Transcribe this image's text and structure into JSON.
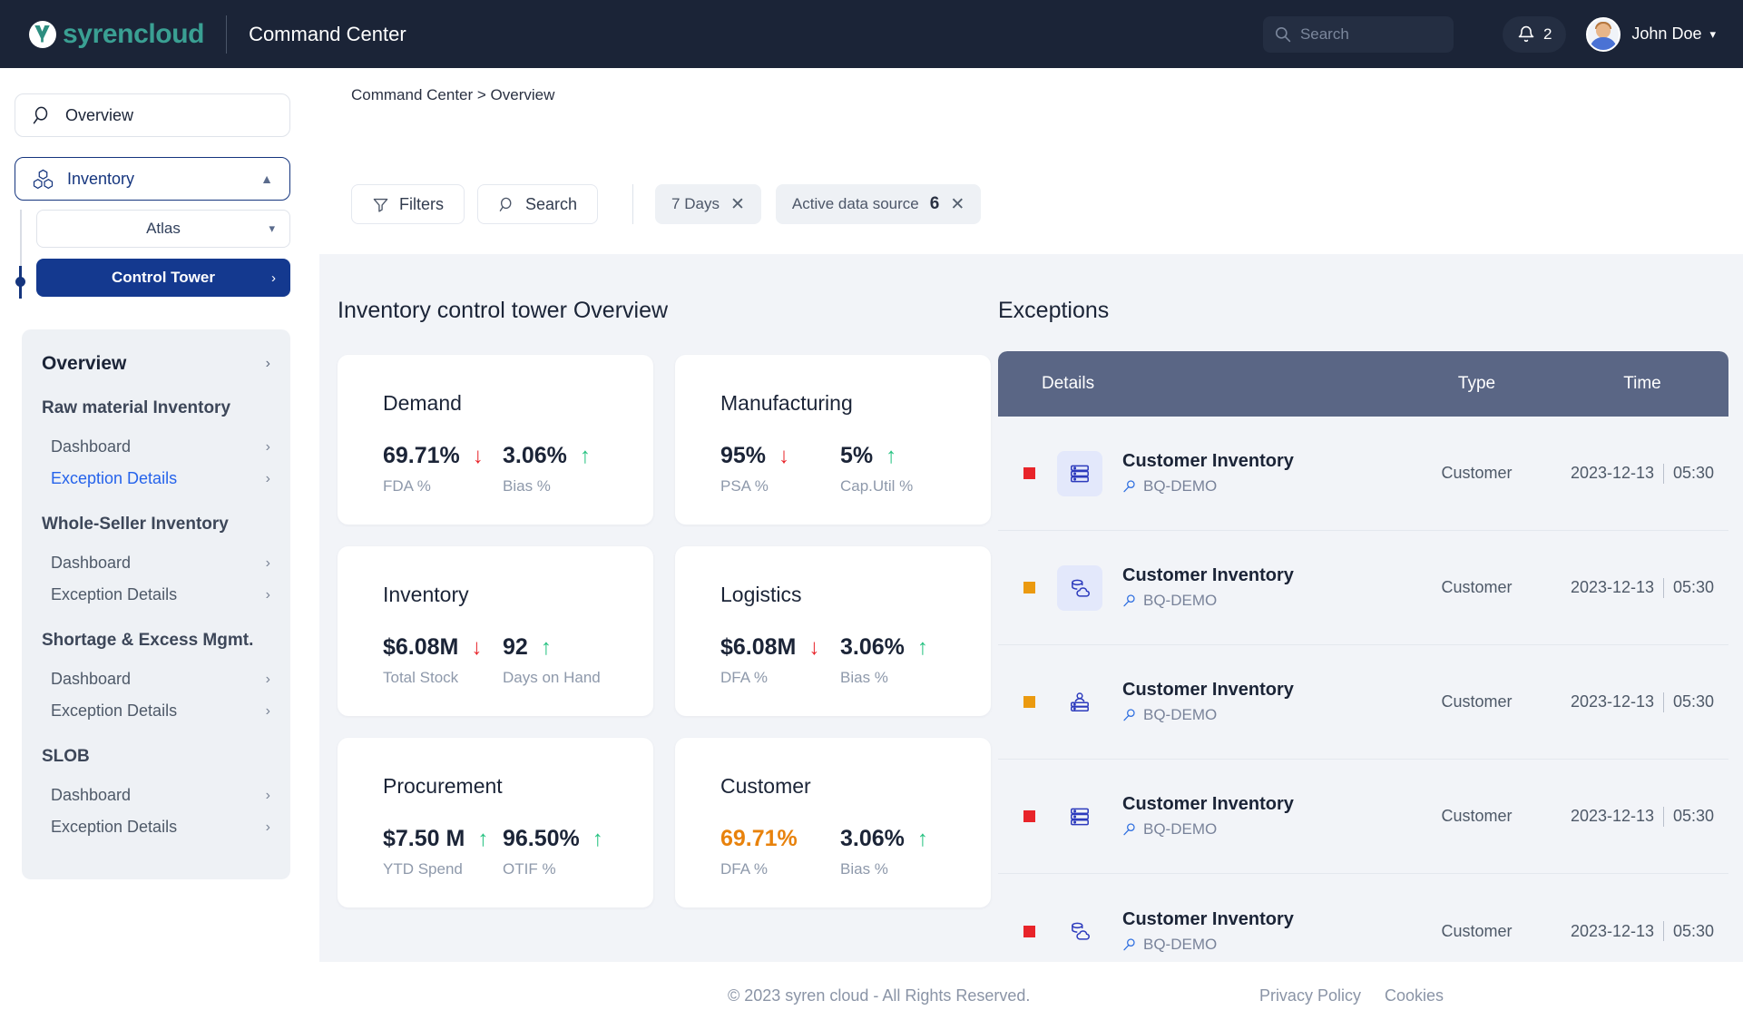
{
  "header": {
    "brand_word1": "syren",
    "brand_word2": "cloud",
    "app_title": "Command Center",
    "search_placeholder": "Search",
    "notification_count": "2",
    "user_name": "John Doe"
  },
  "sidebar": {
    "overview_label": "Overview",
    "inventory_label": "Inventory",
    "select_value": "Atlas",
    "control_tower_label": "Control Tower",
    "panel_title": "Overview",
    "groups": [
      {
        "title": "Raw material Inventory",
        "items": [
          {
            "label": "Dashboard",
            "highlight": false
          },
          {
            "label": "Exception  Details",
            "highlight": true
          }
        ]
      },
      {
        "title": "Whole-Seller Inventory",
        "items": [
          {
            "label": "Dashboard",
            "highlight": false
          },
          {
            "label": "Exception  Details",
            "highlight": false
          }
        ]
      },
      {
        "title": "Shortage & Excess Mgmt.",
        "items": [
          {
            "label": "Dashboard",
            "highlight": false
          },
          {
            "label": "Exception  Details",
            "highlight": false
          }
        ]
      },
      {
        "title": "SLOB",
        "items": [
          {
            "label": "Dashboard",
            "highlight": false
          },
          {
            "label": "Exception  Details",
            "highlight": false
          }
        ]
      }
    ]
  },
  "main": {
    "breadcrumb": "Command Center > Overview",
    "toolbar": {
      "filters_label": "Filters",
      "search_label": "Search",
      "chip_days_label": "7 Days",
      "chip_source_label": "Active data source",
      "chip_source_count": "6"
    },
    "kpi_section_title": "Inventory control tower  Overview",
    "exceptions_title": "Exceptions"
  },
  "chart_data": {
    "type": "table",
    "title": "Inventory control tower  Overview",
    "cards": [
      {
        "name": "Demand",
        "metrics": [
          {
            "value": "69.71%",
            "label": "FDA %",
            "trend": "down",
            "accent": "normal"
          },
          {
            "value": "3.06%",
            "label": "Bias %",
            "trend": "up",
            "accent": "normal"
          }
        ]
      },
      {
        "name": "Manufacturing",
        "metrics": [
          {
            "value": "95%",
            "label": "PSA %",
            "trend": "down",
            "accent": "normal"
          },
          {
            "value": "5%",
            "label": "Cap.Util %",
            "trend": "up",
            "accent": "normal"
          }
        ]
      },
      {
        "name": "Inventory",
        "metrics": [
          {
            "value": "$6.08M",
            "label": "Total Stock",
            "trend": "down",
            "accent": "normal"
          },
          {
            "value": "92",
            "label": "Days on Hand",
            "trend": "up",
            "accent": "normal"
          }
        ]
      },
      {
        "name": "Logistics",
        "metrics": [
          {
            "value": "$6.08M",
            "label": "DFA %",
            "trend": "down",
            "accent": "normal"
          },
          {
            "value": "3.06%",
            "label": "Bias %",
            "trend": "up",
            "accent": "normal"
          }
        ]
      },
      {
        "name": "Procurement",
        "metrics": [
          {
            "value": "$7.50 M",
            "label": "YTD Spend",
            "trend": "up",
            "accent": "normal"
          },
          {
            "value": "96.50%",
            "label": "OTIF %",
            "trend": "up",
            "accent": "normal"
          }
        ]
      },
      {
        "name": "Customer",
        "metrics": [
          {
            "value": "69.71%",
            "label": "DFA %",
            "trend": "none",
            "accent": "warn"
          },
          {
            "value": "3.06%",
            "label": "Bias %",
            "trend": "up",
            "accent": "normal"
          }
        ]
      }
    ]
  },
  "exceptions": {
    "columns": [
      "Details",
      "Type",
      "Time"
    ],
    "rows": [
      {
        "severity": "red",
        "icon": "server-stack-icon",
        "tinted": true,
        "title": "Customer Inventory",
        "source": "BQ-DEMO",
        "type": "Customer",
        "date": "2023-12-13",
        "time": "05:30"
      },
      {
        "severity": "orange",
        "icon": "data-cloud-icon",
        "tinted": true,
        "title": "Customer Inventory",
        "source": "BQ-DEMO",
        "type": "Customer",
        "date": "2023-12-13",
        "time": "05:30"
      },
      {
        "severity": "orange",
        "icon": "database-user-icon",
        "tinted": false,
        "title": "Customer Inventory",
        "source": "BQ-DEMO",
        "type": "Customer",
        "date": "2023-12-13",
        "time": "05:30"
      },
      {
        "severity": "red",
        "icon": "server-stack-icon",
        "tinted": false,
        "title": "Customer Inventory",
        "source": "BQ-DEMO",
        "type": "Customer",
        "date": "2023-12-13",
        "time": "05:30"
      },
      {
        "severity": "red",
        "icon": "data-cloud-icon",
        "tinted": false,
        "title": "Customer Inventory",
        "source": "BQ-DEMO",
        "type": "Customer",
        "date": "2023-12-13",
        "time": "05:30"
      }
    ]
  },
  "footer": {
    "copyright": "© 2023 syren cloud - All Rights Reserved.",
    "links": [
      "Privacy Policy",
      "Cookies"
    ]
  },
  "colors": {
    "brand_teal": "#3aa093",
    "header_bg": "#1b2437",
    "primary_blue": "#14398f",
    "link_blue": "#2563eb",
    "down_red": "#e8242a",
    "up_green": "#26c281",
    "warn_orange": "#e8820c",
    "table_head": "#5a6685"
  }
}
